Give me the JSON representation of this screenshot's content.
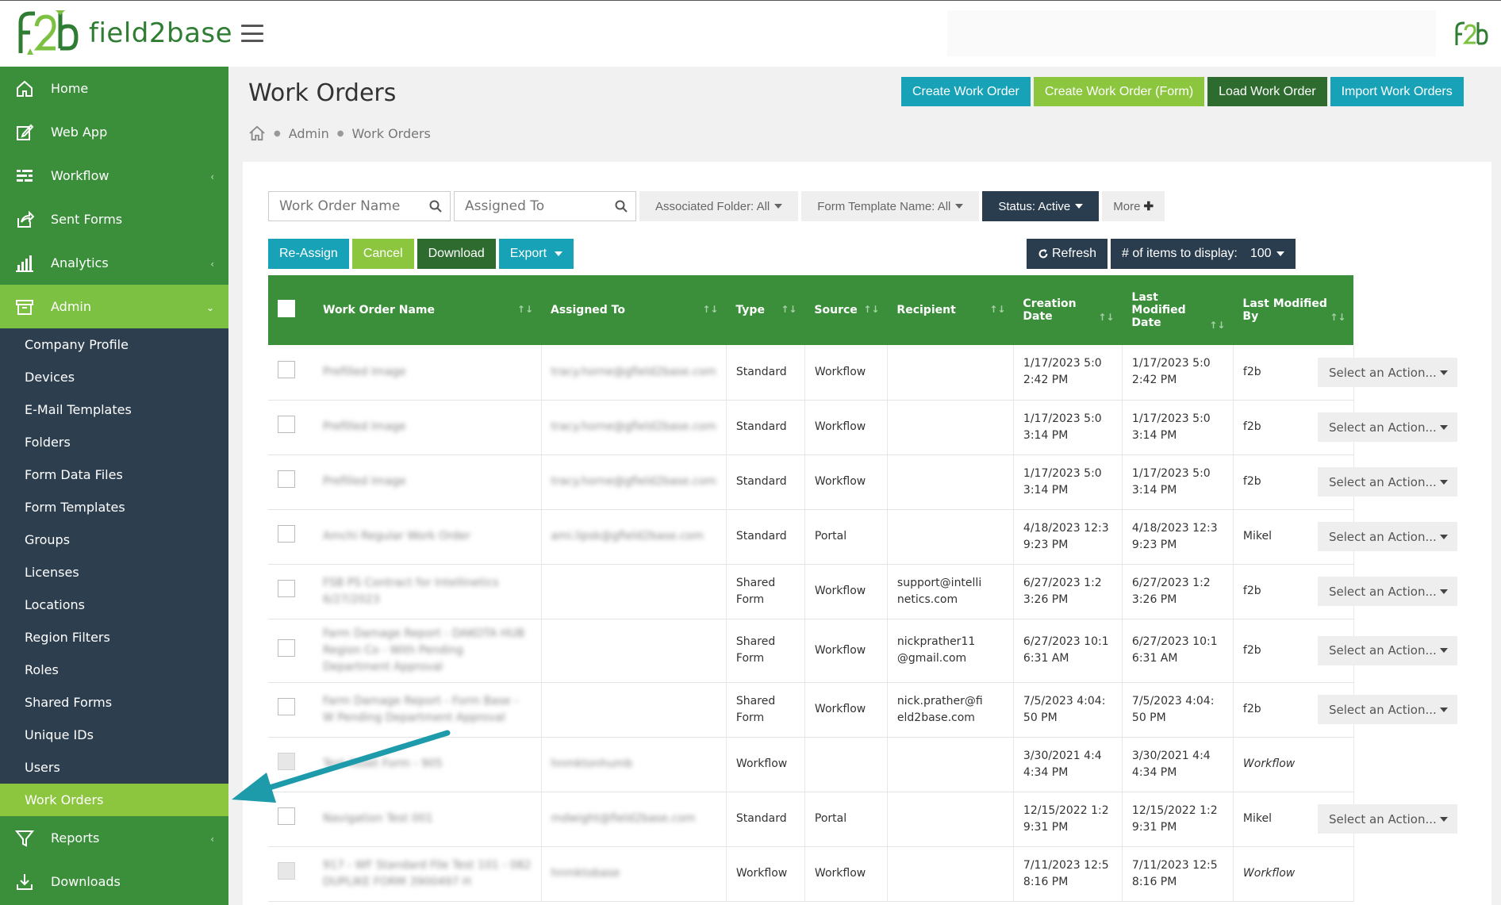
{
  "app": {
    "brand": "field2base"
  },
  "sidebar": {
    "items": [
      {
        "label": "Home",
        "icon": "home-icon"
      },
      {
        "label": "Web App",
        "icon": "edit-icon"
      },
      {
        "label": "Workflow",
        "icon": "workflow-icon"
      },
      {
        "label": "Sent Forms",
        "icon": "share-icon"
      },
      {
        "label": "Analytics",
        "icon": "bar-chart-icon"
      },
      {
        "label": "Admin",
        "icon": "archive-icon"
      }
    ],
    "admin_sub": [
      "Company Profile",
      "Devices",
      "E-Mail Templates",
      "Folders",
      "Form Data Files",
      "Form Templates",
      "Groups",
      "Licenses",
      "Locations",
      "Region Filters",
      "Roles",
      "Shared Forms",
      "Unique IDs",
      "Users",
      "Work Orders"
    ],
    "bottom_items": [
      {
        "label": "Reports",
        "icon": "filter-icon"
      },
      {
        "label": "Downloads",
        "icon": "download-icon"
      }
    ]
  },
  "header": {
    "title": "Work Orders",
    "breadcrumb": [
      "Admin",
      "Work Orders"
    ],
    "buttons": [
      {
        "label": "Create Work Order",
        "color": "#17a2b8"
      },
      {
        "label": "Create Work Order (Form)",
        "color": "#8cc63f"
      },
      {
        "label": "Load Work Order",
        "color": "#2e6b2e"
      },
      {
        "label": "Import Work Orders",
        "color": "#17a2b8"
      }
    ]
  },
  "filters": {
    "work_order_name_placeholder": "Work Order Name",
    "assigned_to_placeholder": "Assigned To",
    "associated_folder": "Associated Folder: All",
    "form_template": "Form Template Name: All",
    "status": "Status: Active",
    "more": "More"
  },
  "actions": {
    "reassign": "Re-Assign",
    "cancel": "Cancel",
    "download": "Download",
    "export": "Export",
    "refresh": "Refresh",
    "items_label": "# of items to display:",
    "items_value": "100"
  },
  "table": {
    "columns": [
      "Work Order Name",
      "Assigned To",
      "Type",
      "Source",
      "Recipient",
      "Creation Date",
      "Last Modified Date",
      "Last Modified By"
    ],
    "action_label": "Select an Action...",
    "rows": [
      {
        "name": "Prefilled Image",
        "assigned": "tracy.horne@gfield2base.com",
        "type": "Standard",
        "source": "Workflow",
        "recipient": "",
        "created": "1/17/2023 5:02:42 PM",
        "modified": "1/17/2023 5:02:42 PM",
        "by": "f2b",
        "by_italic": false,
        "has_action": true,
        "cb_disabled": false
      },
      {
        "name": "Prefilled Image",
        "assigned": "tracy.horne@gfield2base.com",
        "type": "Standard",
        "source": "Workflow",
        "recipient": "",
        "created": "1/17/2023 5:03:14 PM",
        "modified": "1/17/2023 5:03:14 PM",
        "by": "f2b",
        "by_italic": false,
        "has_action": true,
        "cb_disabled": false
      },
      {
        "name": "Prefilled Image",
        "assigned": "tracy.horne@gfield2base.com",
        "type": "Standard",
        "source": "Workflow",
        "recipient": "",
        "created": "1/17/2023 5:03:14 PM",
        "modified": "1/17/2023 5:03:14 PM",
        "by": "f2b",
        "by_italic": false,
        "has_action": true,
        "cb_disabled": false
      },
      {
        "name": "Amchi Regular Work Order",
        "assigned": "ami.lipsk@gfield2base.com",
        "type": "Standard",
        "source": "Portal",
        "recipient": "",
        "created": "4/18/2023 12:39:23 PM",
        "modified": "4/18/2023 12:39:23 PM",
        "by": "Mikel",
        "by_italic": false,
        "has_action": true,
        "cb_disabled": false
      },
      {
        "name": "FSB PS Contract for Intellinetics 6/27/2023",
        "assigned": "",
        "type": "Shared Form",
        "source": "Workflow",
        "recipient": "support@intellinetics.com",
        "created": "6/27/2023 1:23:26 PM",
        "modified": "6/27/2023 1:23:26 PM",
        "by": "f2b",
        "by_italic": false,
        "has_action": true,
        "cb_disabled": false
      },
      {
        "name": "Farm Damage Report - DAKOTA HUB Region Co - With Pending Department Approval",
        "assigned": "",
        "type": "Shared Form",
        "source": "Workflow",
        "recipient": "nickprather11@gmail.com",
        "created": "6/27/2023 10:16:31 AM",
        "modified": "6/27/2023 10:16:31 AM",
        "by": "f2b",
        "by_italic": false,
        "has_action": true,
        "cb_disabled": false
      },
      {
        "name": "Farm Damage Report - Form Base - W Pending Department Approval",
        "assigned": "",
        "type": "Shared Form",
        "source": "Workflow",
        "recipient": "nick.prather@field2base.com",
        "created": "7/5/2023 4:04:50 PM",
        "modified": "7/5/2023 4:04:50 PM",
        "by": "f2b",
        "by_italic": false,
        "has_action": true,
        "cb_disabled": false
      },
      {
        "name": "Test Asset Form - 905",
        "assigned": "hnmktonhumb",
        "type": "Workflow",
        "source": "",
        "recipient": "",
        "created": "3/30/2021 4:44:34 PM",
        "modified": "3/30/2021 4:44:34 PM",
        "by": "Workflow",
        "by_italic": true,
        "has_action": false,
        "cb_disabled": true
      },
      {
        "name": "Navigation Test 001",
        "assigned": "mdwight@field2base.com",
        "type": "Standard",
        "source": "Portal",
        "recipient": "",
        "created": "12/15/2022 1:29:31 PM",
        "modified": "12/15/2022 1:29:31 PM",
        "by": "Mikel",
        "by_italic": false,
        "has_action": true,
        "cb_disabled": false
      },
      {
        "name": "917 - WF Standard File Test 101 - 082 DUPLIKE FORM 3900497 H",
        "assigned": "hnmktobase",
        "type": "Workflow",
        "source": "Workflow",
        "recipient": "",
        "created": "7/11/2023 12:58:16 PM",
        "modified": "7/11/2023 12:58:16 PM",
        "by": "Workflow",
        "by_italic": true,
        "has_action": false,
        "cb_disabled": true
      }
    ]
  },
  "colors": {
    "sidebar_green": "#3b8f3b",
    "lime": "#8cc63f",
    "dark_navy": "#2d3e4f",
    "teal": "#17a2b8",
    "arrow": "#1e9bab"
  }
}
